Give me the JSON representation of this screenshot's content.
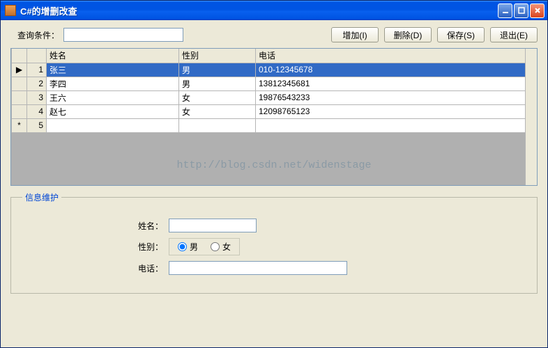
{
  "window": {
    "title": "C#的增删改查"
  },
  "query": {
    "label": "查询条件：",
    "value": ""
  },
  "buttons": {
    "add": "增加(I)",
    "delete": "删除(D)",
    "save": "保存(S)",
    "exit": "退出(E)"
  },
  "grid": {
    "columns": {
      "name": "姓名",
      "gender": "性别",
      "phone": "电话"
    },
    "rows": [
      {
        "num": "1",
        "marker": "▶",
        "name": "张三",
        "gender": "男",
        "phone": "010-12345678",
        "selected": true
      },
      {
        "num": "2",
        "marker": "",
        "name": "李四",
        "gender": "男",
        "phone": "13812345681",
        "selected": false
      },
      {
        "num": "3",
        "marker": "",
        "name": "王六",
        "gender": "女",
        "phone": "19876543233",
        "selected": false
      },
      {
        "num": "4",
        "marker": "",
        "name": "赵七",
        "gender": "女",
        "phone": "12098765123",
        "selected": false
      },
      {
        "num": "5",
        "marker": "*",
        "name": "",
        "gender": "",
        "phone": "",
        "selected": false
      }
    ]
  },
  "watermark": "http://blog.csdn.net/widenstage",
  "form": {
    "legend": "信息维护",
    "name_label": "姓名：",
    "name_value": "",
    "gender_label": "性别：",
    "gender_male": "男",
    "gender_female": "女",
    "gender_selected": "male",
    "phone_label": "电话：",
    "phone_value": ""
  }
}
